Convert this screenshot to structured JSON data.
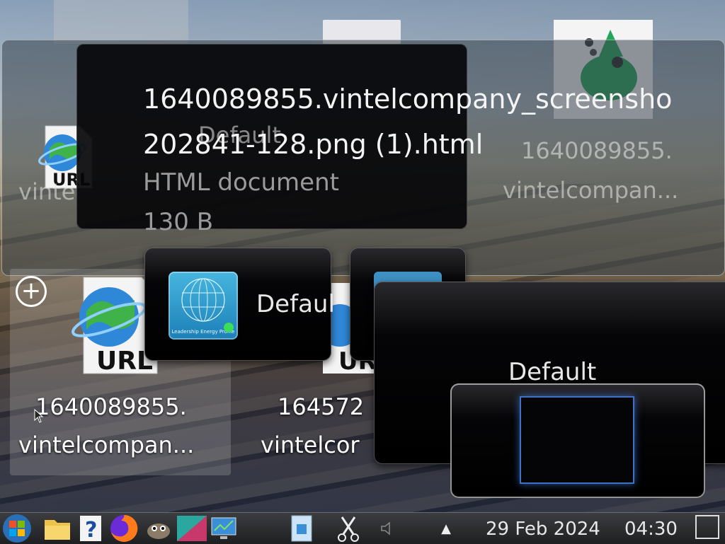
{
  "top_icons": {
    "right_icon_caption_line1": "1640089855.",
    "right_icon_caption_line2": "vintelcompan..."
  },
  "info_popup": {
    "title_line1": "1640089855.vintelcompany_screensho",
    "title_line2": "202841-128.png (1).html",
    "type": "HTML document",
    "size": "130 B",
    "ghost_default": "Default",
    "ghost_left": "vinte"
  },
  "desktop_icons": [
    {
      "line1": "1640089855.",
      "line2": "vintelcompan..."
    },
    {
      "line1": "164572",
      "line2": "vintelcor"
    }
  ],
  "switcher": {
    "item1_label": "Defaul",
    "leader_icon_text": "Leadership Energy Profile",
    "big_label": "Default"
  },
  "taskbar": {
    "date": "29 Feb 2024",
    "time": "04:30",
    "tray_arrow": "▲"
  },
  "colors": {
    "accent_blue": "#3f71c7",
    "taskbar_bg": "#2a2b2d"
  }
}
